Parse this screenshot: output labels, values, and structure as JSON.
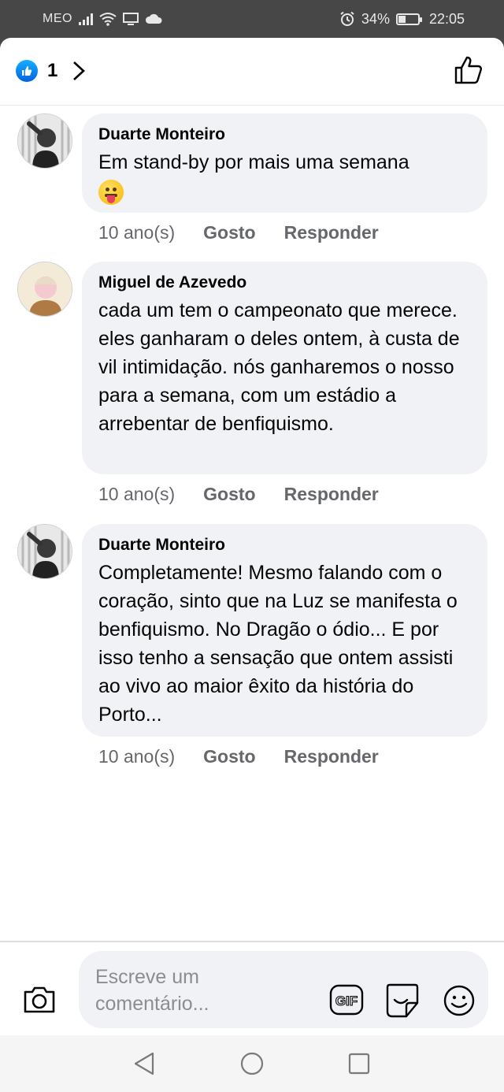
{
  "status_bar": {
    "carrier": "MEO",
    "battery_percent": "34%",
    "battery_level": 0.34,
    "time": "22:05",
    "icons": [
      "signal-icon",
      "wifi-icon",
      "screen-icon",
      "cloud-icon",
      "alarm-icon",
      "battery-icon"
    ]
  },
  "header": {
    "reaction_icon": "like-reaction-icon",
    "reaction_count": "1",
    "like_button_icon": "thumbs-up-outline-icon"
  },
  "comments": [
    {
      "author": "Duarte Monteiro",
      "text": "Em stand-by por mais uma semana",
      "emoji": "face-with-tongue",
      "time": "10 ano(s)",
      "like_label": "Gosto",
      "reply_label": "Responder"
    },
    {
      "author": "Miguel de Azevedo",
      "text": "cada um tem o campeonato que merece. eles ganharam o deles ontem, à custa de vil intimidação. nós ganharemos o nosso para a semana, com um estádio a arrebentar de benfiquismo.",
      "time": "10 ano(s)",
      "like_label": "Gosto",
      "reply_label": "Responder"
    },
    {
      "author": "Duarte Monteiro",
      "text": "Completamente! Mesmo falando com o coração, sinto que na Luz se manifesta o benfiquismo. No Dragão o ódio... E por isso tenho a sensação que ontem assisti ao vivo ao maior êxito da história do Porto...",
      "time": "10 ano(s)",
      "like_label": "Gosto",
      "reply_label": "Responder"
    }
  ],
  "composer": {
    "placeholder": "Escreve um comentário...",
    "gif_label": "GIF"
  },
  "colors": {
    "accent_blue": "#1877f2",
    "bubble_bg": "#f0f2f5",
    "meta_text": "#65676b"
  }
}
